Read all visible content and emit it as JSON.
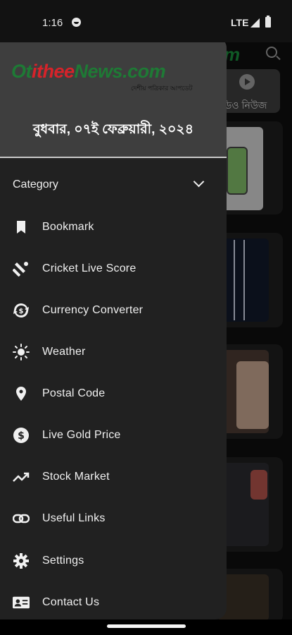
{
  "status_bar": {
    "time": "1:16",
    "network": "LTE"
  },
  "background": {
    "logo_fragment": "m",
    "video_tab_label": "ডিও নিউজ"
  },
  "drawer": {
    "logo": {
      "part_a": "Ot",
      "part_b": "ithee",
      "part_c": "News.com",
      "tagline": "দেশীয় পত্রিকার আপডেট"
    },
    "date": "বুধবার, ০৭ই ফেব্রুয়ারী, ২০২৪",
    "category_label": "Category",
    "items": [
      {
        "label": "Bookmark",
        "icon": "bookmark-icon"
      },
      {
        "label": "Cricket Live Score",
        "icon": "cricket-icon"
      },
      {
        "label": "Currency Converter",
        "icon": "currency-exchange-icon"
      },
      {
        "label": "Weather",
        "icon": "sun-icon"
      },
      {
        "label": "Postal Code",
        "icon": "location-pin-icon"
      },
      {
        "label": "Live Gold Price",
        "icon": "dollar-coin-icon"
      },
      {
        "label": "Stock Market",
        "icon": "trending-up-icon"
      },
      {
        "label": "Useful Links",
        "icon": "link-icon"
      },
      {
        "label": "Settings",
        "icon": "gear-icon"
      },
      {
        "label": "Contact Us",
        "icon": "contact-card-icon"
      }
    ]
  }
}
